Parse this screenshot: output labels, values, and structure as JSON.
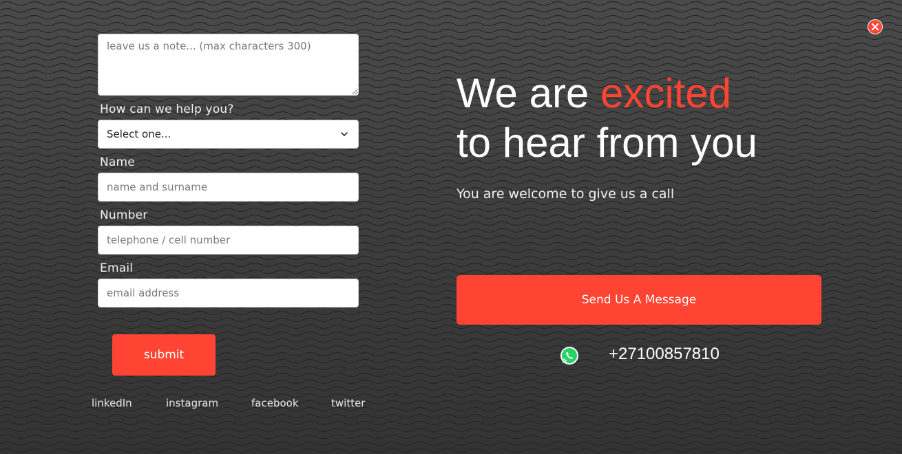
{
  "close": {
    "icon": "close-icon",
    "color": "#ff4433"
  },
  "form": {
    "note_placeholder": "leave us a note... (max characters 300)",
    "help_label": "How can we help you?",
    "help_select_value": "Select one...",
    "name_label": "Name",
    "name_placeholder": "name and surname",
    "number_label": "Number",
    "number_placeholder": "telephone / cell number",
    "email_label": "Email",
    "email_placeholder": "email address",
    "submit_label": "submit"
  },
  "social": {
    "items": [
      {
        "label": "linkedIn"
      },
      {
        "label": "instagram"
      },
      {
        "label": "facebook"
      },
      {
        "label": "twitter"
      }
    ]
  },
  "hero": {
    "title_part1": "We are ",
    "title_accent": "excited",
    "title_line2": "to hear from you",
    "subtitle": "You are welcome to give us a call",
    "message_button": "Send Us A Message",
    "whatsapp_icon": "whatsapp-icon",
    "phone": "+27100857810"
  },
  "colors": {
    "accent": "#ff4433",
    "background": "#3a3a3a",
    "text": "#ffffff"
  }
}
